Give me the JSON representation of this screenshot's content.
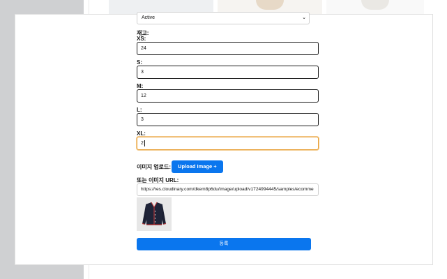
{
  "status": {
    "selected": "Active"
  },
  "stock": {
    "title": "재고:",
    "sizes": [
      {
        "label": "XS:",
        "value": "24"
      },
      {
        "label": "S:",
        "value": "3"
      },
      {
        "label": "M:",
        "value": "12"
      },
      {
        "label": "L:",
        "value": "3"
      },
      {
        "label": "XL:",
        "value": "2"
      }
    ]
  },
  "image": {
    "upload_label": "이미지 업로드:",
    "upload_button": "Upload Image +",
    "url_label": "또는 이미지 URL:",
    "url_value": "https://res.cloudinary.com/dkem8p6du/image/upload/v1724994445/samples/ecomme"
  },
  "submit_label": "등록",
  "colors": {
    "accent": "#0a76ee",
    "focus": "#e8a33d"
  }
}
